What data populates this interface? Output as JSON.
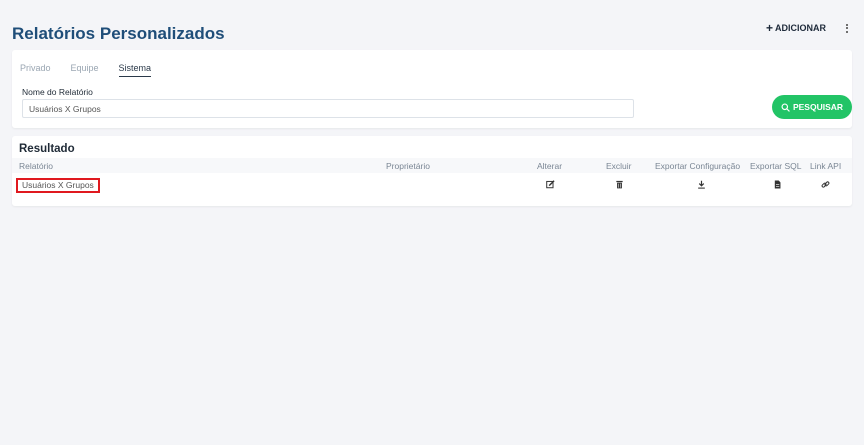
{
  "header": {
    "title": "Relatórios Personalizados",
    "add_label": "ADICIONAR",
    "add_symbol": "+"
  },
  "filter": {
    "tabs": [
      {
        "label": "Privado",
        "active": false
      },
      {
        "label": "Equipe",
        "active": false
      },
      {
        "label": "Sistema",
        "active": true
      }
    ],
    "field_label": "Nome do Relatório",
    "field_value": "Usuários X Grupos",
    "search_label": "PESQUISAR"
  },
  "results": {
    "title": "Resultado",
    "columns": [
      "Relatório",
      "Proprietário",
      "Alterar",
      "Excluir",
      "Exportar Configuração",
      "Exportar SQL",
      "Link API"
    ],
    "rows": [
      {
        "name": "Usuários X Grupos",
        "owner": ""
      }
    ]
  },
  "icons": {
    "more": "vertical-dots-icon",
    "search": "magnifier-icon",
    "edit": "edit-icon",
    "delete": "trash-icon",
    "export_config": "download-icon",
    "export_sql": "file-icon",
    "link_api": "link-icon"
  },
  "colors": {
    "title": "#1f4e79",
    "search_button": "#22c466",
    "highlight": "#e0191f",
    "background": "#f4f5f8"
  }
}
